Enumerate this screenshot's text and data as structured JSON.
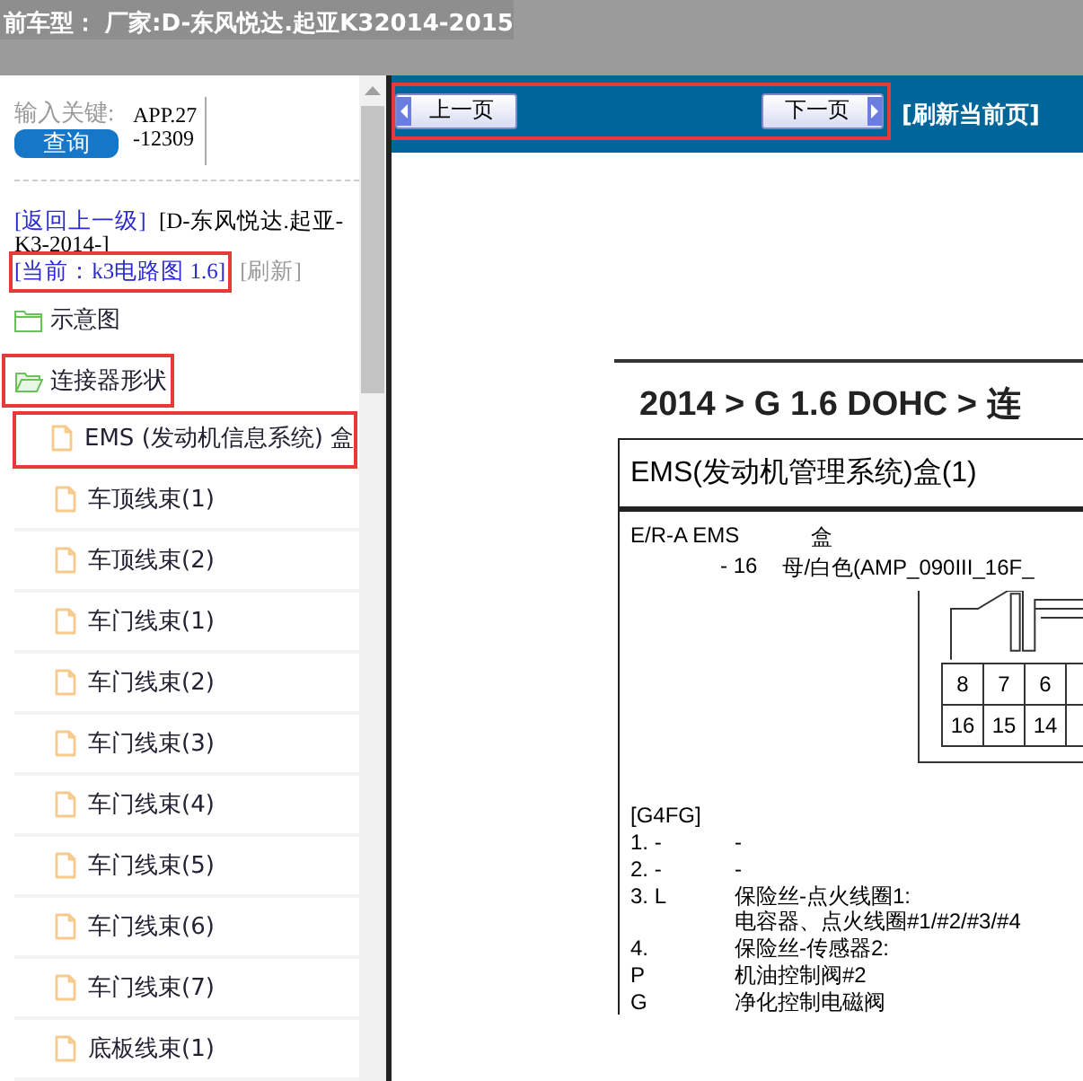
{
  "title_bar": {
    "title": "前车型： 厂家:D-东风悦达.起亚K32014-2015"
  },
  "sidebar": {
    "search": {
      "label": "输入关键:",
      "value": "APP.27-12309",
      "button": "查询"
    },
    "back_link": "[返回上一级]",
    "path": "[D-东风悦达.起亚-K3-2014-]",
    "current": {
      "text": "[当前：k3电路图 1.6]",
      "highlighted": true
    },
    "refresh": "[刷新]",
    "tree": [
      {
        "label": "示意图",
        "kind": "folder",
        "expanded": false,
        "highlighted": false
      },
      {
        "label": "连接器形状",
        "kind": "folder",
        "expanded": true,
        "highlighted": true,
        "children": [
          {
            "label": "EMS (发动机信息系统) 盒",
            "kind": "file",
            "highlighted": true
          },
          {
            "label": "车顶线束(1)",
            "kind": "file",
            "highlighted": false
          },
          {
            "label": "车顶线束(2)",
            "kind": "file",
            "highlighted": false
          },
          {
            "label": "车门线束(1)",
            "kind": "file",
            "highlighted": false
          },
          {
            "label": "车门线束(2)",
            "kind": "file",
            "highlighted": false
          },
          {
            "label": "车门线束(3)",
            "kind": "file",
            "highlighted": false
          },
          {
            "label": "车门线束(4)",
            "kind": "file",
            "highlighted": false
          },
          {
            "label": "车门线束(5)",
            "kind": "file",
            "highlighted": false
          },
          {
            "label": "车门线束(6)",
            "kind": "file",
            "highlighted": false
          },
          {
            "label": "车门线束(7)",
            "kind": "file",
            "highlighted": false
          },
          {
            "label": "底板线束(1)",
            "kind": "file",
            "highlighted": false
          }
        ]
      }
    ]
  },
  "toolbar": {
    "highlighted": true,
    "prev": "上一页",
    "next": "下一页",
    "refresh": "[刷新当前页]"
  },
  "document": {
    "heading": "2014 > G 1.6 DOHC > 连",
    "box_title": "EMS(发动机管理系统)盒(1)",
    "connector_name": "E/R-A EMS",
    "connector_type": "盒",
    "pin_count": "- 16",
    "connector_desc": "母/白色(AMP_090III_16F_",
    "pin_grid": [
      [
        "8",
        "7",
        "6"
      ],
      [
        "16",
        "15",
        "14"
      ]
    ],
    "engine": "[G4FG]",
    "pins": [
      {
        "pin": "1. -",
        "desc": [
          "-"
        ]
      },
      {
        "pin": "2. -",
        "desc": [
          "-"
        ]
      },
      {
        "pin": "3. L",
        "desc": [
          "保险丝-点火线圈1:",
          "电容器、点火线圈#1/#2/#3/#4"
        ]
      },
      {
        "pin": "4.",
        "desc": [
          "保险丝-传感器2:"
        ]
      },
      {
        "pin": "P",
        "desc": [
          "机油控制阀#2"
        ]
      },
      {
        "pin": "G",
        "desc": [
          "净化控制电磁阀"
        ]
      }
    ]
  }
}
